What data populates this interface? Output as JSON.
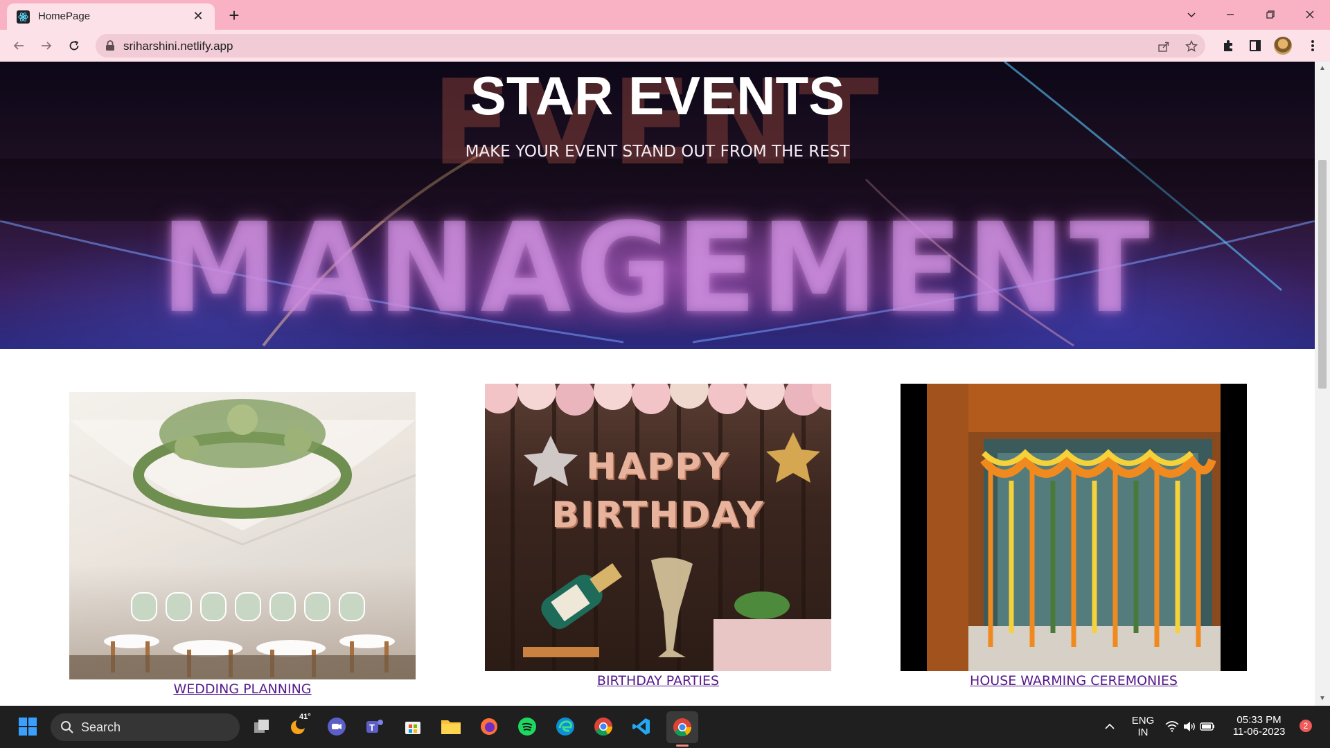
{
  "browser": {
    "tab_title": "HomePage",
    "url": "sriharshini.netlify.app"
  },
  "page": {
    "hero_title": "STAR EVENTS",
    "hero_subtitle": "MAKE YOUR EVENT STAND OUT FROM THE REST",
    "hero_bg_text_top": "EVENT",
    "hero_bg_text_bottom": "MANAGEMENT",
    "cards": [
      {
        "label": "WEDDING PLANNING"
      },
      {
        "label": "BIRTHDAY PARTIES"
      },
      {
        "label": "HOUSE WARMING CEREMONIES"
      }
    ],
    "birthday_balloon_text": [
      "HAPPY",
      "BIRTHDAY"
    ]
  },
  "taskbar": {
    "search_label": "Search",
    "weather_temp": "41°",
    "language": "ENG",
    "region": "IN",
    "time": "05:33 PM",
    "date": "11-06-2023",
    "notifications": "2"
  },
  "colors": {
    "tab_strip": "#f9b2c4",
    "toolbar": "#fde1e8",
    "link_visited": "#551a8b",
    "taskbar": "#1f1f1f"
  }
}
